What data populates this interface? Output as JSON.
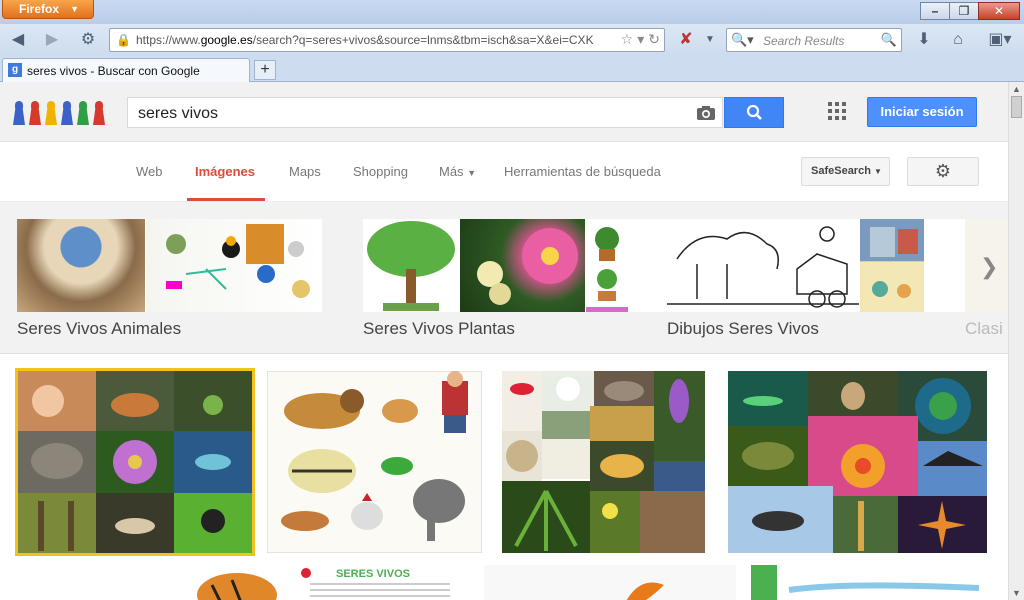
{
  "browser": {
    "app_button": "Firefox",
    "url_prefix": "https://www.",
    "url_domain": "google.es",
    "url_rest": "/search?q=seres+vivos&source=lnms&tbm=isch&sa=X&ei=CXK",
    "search_placeholder": "Search Results",
    "tab_title": "seres vivos - Buscar con Google",
    "new_tab": "+"
  },
  "google": {
    "query": "seres vivos",
    "signin": "Iniciar sesión",
    "nav": [
      "Web",
      "Imágenes",
      "Maps",
      "Shopping",
      "Más",
      "Herramientas de búsqueda"
    ],
    "safesearch": "SafeSearch"
  },
  "related": [
    {
      "label": "Seres Vivos Animales"
    },
    {
      "label": "Seres Vivos Plantas"
    },
    {
      "label": "Dibujos Seres Vivos"
    },
    {
      "label": "Clasi"
    }
  ],
  "colors": {
    "accent_red": "#dd4b39",
    "google_blue": "#4285f4",
    "firefox_orange": "#e2711d"
  }
}
